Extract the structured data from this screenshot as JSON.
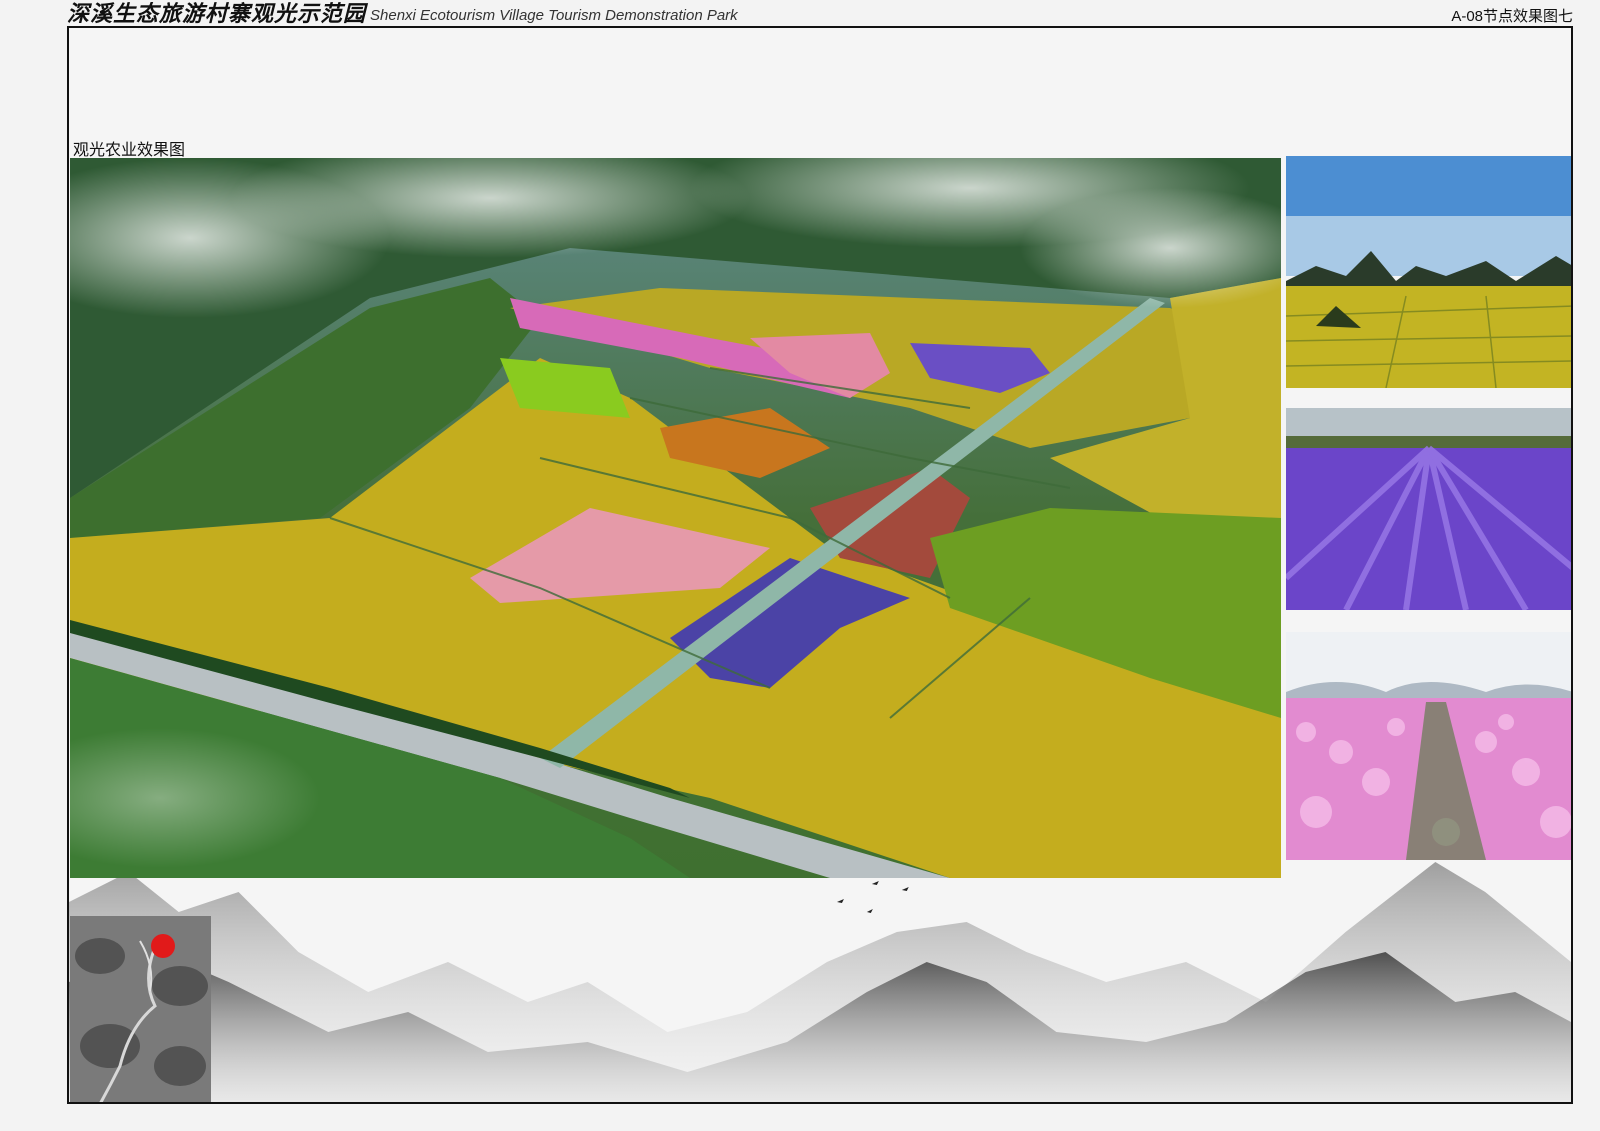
{
  "header": {
    "title_cn": "深溪生态旅游村寨观光示范园",
    "title_en": "Shenxi Ecotourism Village Tourism Demonstration Park",
    "sheet_id": "A-08节点效果图七"
  },
  "section": {
    "label": "观光农业效果图"
  },
  "colors": {
    "frame": "#111111",
    "background": "#f3f3f3",
    "fields_yellow": "#c9b21a",
    "fields_pink": "#e08fb3",
    "fields_purple": "#5a4ab0",
    "site_marker": "#e11a1a"
  }
}
